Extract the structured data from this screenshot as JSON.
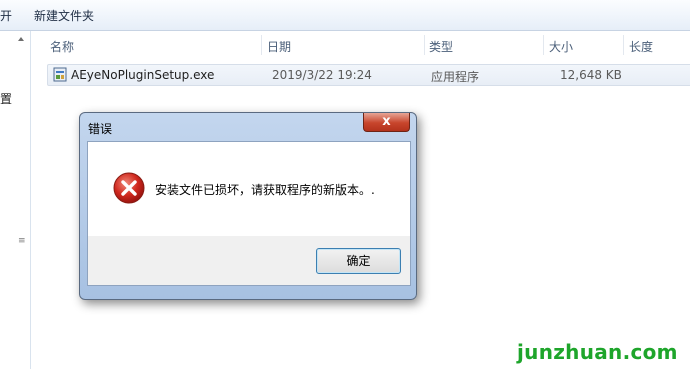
{
  "toolbar": {
    "cut_label": "开",
    "new_folder_label": "新建文件夹"
  },
  "nav": {
    "partial_label": "置"
  },
  "columns": {
    "name": "名称",
    "date": "日期",
    "type": "类型",
    "size": "大小",
    "length": "长度"
  },
  "file": {
    "name": "AEyeNoPluginSetup.exe",
    "date": "2019/3/22 19:24",
    "type": "应用程序",
    "size": "12,648 KB"
  },
  "dialog": {
    "title": "错误",
    "close_label": "x",
    "message": "安装文件已损坏，请获取程序的新版本。.",
    "ok_label": "确定"
  },
  "watermark": "junzhuan.com",
  "colors": {
    "error_red": "#c62828",
    "watermark_green": "#1ea52b",
    "close_button": "#c8452c"
  }
}
